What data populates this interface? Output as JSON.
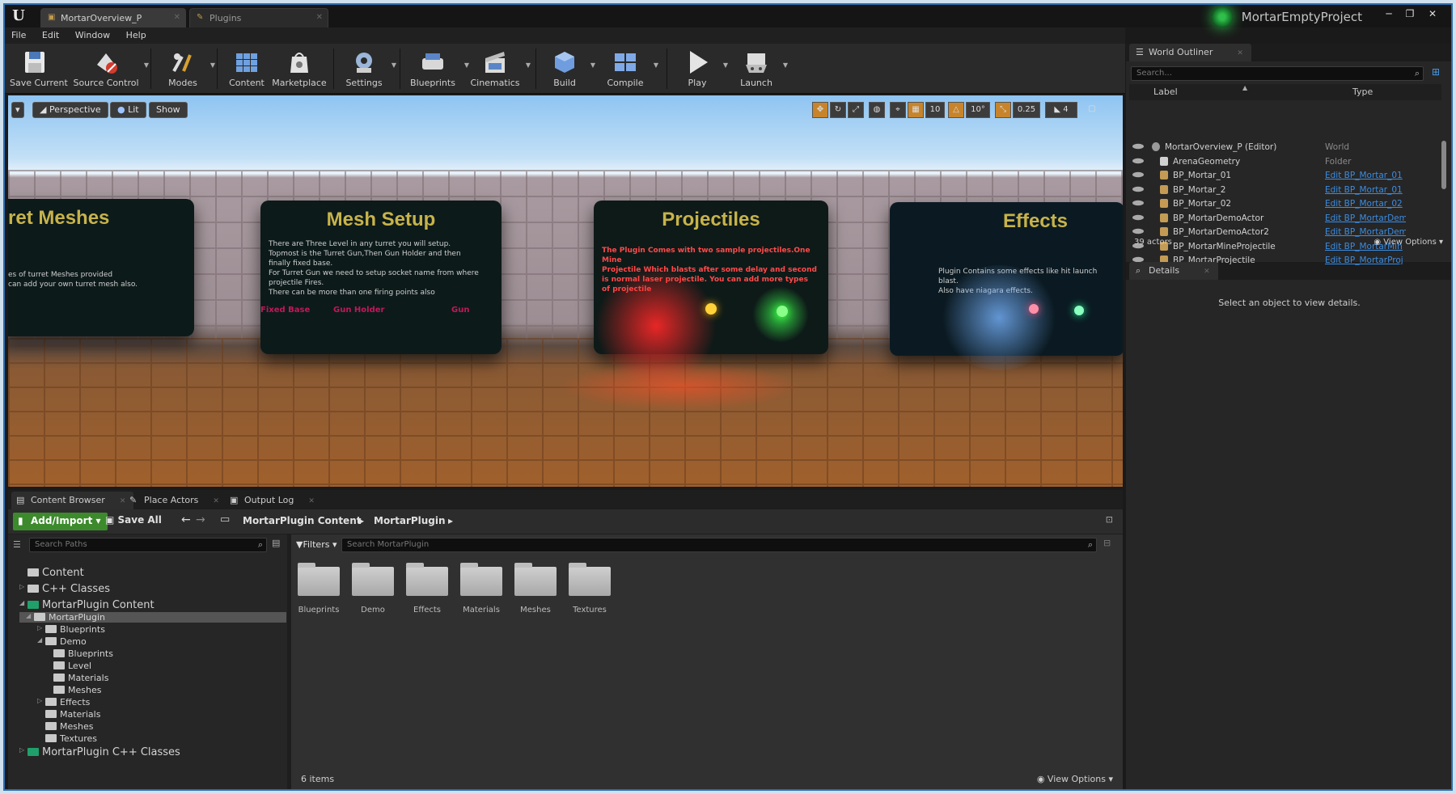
{
  "titlebar": {
    "logo": "U",
    "tabs": [
      {
        "label": "MortarOverview_P"
      },
      {
        "label": "Plugins"
      }
    ],
    "project_name": "MortarEmptyProject",
    "window_controls": [
      "─",
      "❐",
      "✕"
    ]
  },
  "menu": [
    "File",
    "Edit",
    "Window",
    "Help"
  ],
  "toolbar": {
    "save_current": "Save Current",
    "source_control": "Source Control",
    "modes": "Modes",
    "content": "Content",
    "marketplace": "Marketplace",
    "settings": "Settings",
    "blueprints": "Blueprints",
    "cinematics": "Cinematics",
    "build": "Build",
    "compile": "Compile",
    "play": "Play",
    "launch": "Launch"
  },
  "viewport": {
    "menu_arrow": "▾",
    "perspective": "Perspective",
    "lit": "Lit",
    "show": "Show",
    "grid_snap": "10",
    "rotation_snap": "10°",
    "scale_snap": "0.25",
    "camera_speed": "4",
    "panels": [
      {
        "title": "ret Meshes",
        "text": "es of turret Meshes provided\ncan add your own turret mesh also.",
        "red": false
      },
      {
        "title": "Mesh Setup",
        "text": "There are Three Level in any turret you will setup.\nTopmost is the Turret Gun,Then Gun Holder and then\nfinally fixed base.\nFor Turret Gun we need to setup socket name from where\nprojectile Fires.\nThere can be more than one firing points also",
        "red": false,
        "labels": [
          "Fixed Base",
          "Gun Holder",
          "Gun"
        ]
      },
      {
        "title": "Projectiles",
        "text": "The Plugin Comes with two sample projectiles.One Mine\nProjectile Which blasts after some delay and second\nis normal laser projectile. You can add more types\nof projectile",
        "red": true
      },
      {
        "title": "Effects",
        "text": "Plugin Contains some effects like hit launch blast.\nAlso have niagara effects.",
        "red": false
      }
    ]
  },
  "outliner": {
    "tab": "World Outliner",
    "search_placeholder": "Search...",
    "col_label": "Label",
    "col_type": "Type",
    "rows": [
      {
        "label": "MortarOverview_P (Editor)",
        "type": "World",
        "link": false,
        "indent": 0
      },
      {
        "label": "ArenaGeometry",
        "type": "Folder",
        "link": false,
        "indent": 1
      },
      {
        "label": "BP_Mortar_01",
        "type": "Edit BP_Mortar_01",
        "link": true,
        "indent": 1
      },
      {
        "label": "BP_Mortar_2",
        "type": "Edit BP_Mortar_01",
        "link": true,
        "indent": 1
      },
      {
        "label": "BP_Mortar_02",
        "type": "Edit BP_Mortar_02",
        "link": true,
        "indent": 1
      },
      {
        "label": "BP_MortarDemoActor",
        "type": "Edit BP_MortarDem",
        "link": true,
        "indent": 1
      },
      {
        "label": "BP_MortarDemoActor2",
        "type": "Edit BP_MortarDem",
        "link": true,
        "indent": 1
      },
      {
        "label": "BP_MortarMineProjectile",
        "type": "Edit BP_MortarMin",
        "link": true,
        "indent": 1
      },
      {
        "label": "BP_MortarProjectile",
        "type": "Edit BP_MortarProj",
        "link": true,
        "indent": 1
      }
    ],
    "actor_count": "39 actors",
    "view_options": "View Options"
  },
  "details": {
    "tab": "Details",
    "empty_text": "Select an object to view details."
  },
  "content_browser": {
    "tabs": [
      "Content Browser",
      "Place Actors",
      "Output Log"
    ],
    "add_import": "Add/Import",
    "save_all": "Save All",
    "breadcrumb": [
      "MortarPlugin Content",
      "MortarPlugin"
    ],
    "search_paths_placeholder": "Search Paths",
    "filters": "Filters",
    "search_placeholder": "Search MortarPlugin",
    "tree": [
      {
        "label": "Content",
        "level": 0,
        "big": true,
        "arrow": "",
        "green": false,
        "selected": false
      },
      {
        "label": "C++ Classes",
        "level": 0,
        "big": true,
        "arrow": "▷",
        "green": false,
        "selected": false
      },
      {
        "label": "MortarPlugin Content",
        "level": 0,
        "big": true,
        "arrow": "◢",
        "green": true,
        "selected": false
      },
      {
        "label": "MortarPlugin",
        "level": 1,
        "big": false,
        "arrow": "◢",
        "green": false,
        "selected": true
      },
      {
        "label": "Blueprints",
        "level": 2,
        "big": false,
        "arrow": "▷",
        "green": false,
        "selected": false
      },
      {
        "label": "Demo",
        "level": 2,
        "big": false,
        "arrow": "◢",
        "green": false,
        "selected": false
      },
      {
        "label": "Blueprints",
        "level": 3,
        "big": false,
        "arrow": "",
        "green": false,
        "selected": false
      },
      {
        "label": "Level",
        "level": 3,
        "big": false,
        "arrow": "",
        "green": false,
        "selected": false
      },
      {
        "label": "Materials",
        "level": 3,
        "big": false,
        "arrow": "",
        "green": false,
        "selected": false
      },
      {
        "label": "Meshes",
        "level": 3,
        "big": false,
        "arrow": "",
        "green": false,
        "selected": false
      },
      {
        "label": "Effects",
        "level": 2,
        "big": false,
        "arrow": "▷",
        "green": false,
        "selected": false
      },
      {
        "label": "Materials",
        "level": 2,
        "big": false,
        "arrow": "",
        "green": false,
        "selected": false
      },
      {
        "label": "Meshes",
        "level": 2,
        "big": false,
        "arrow": "",
        "green": false,
        "selected": false
      },
      {
        "label": "Textures",
        "level": 2,
        "big": false,
        "arrow": "",
        "green": false,
        "selected": false
      },
      {
        "label": "MortarPlugin C++ Classes",
        "level": 0,
        "big": true,
        "arrow": "▷",
        "green": true,
        "selected": false
      }
    ],
    "folders": [
      "Blueprints",
      "Demo",
      "Effects",
      "Materials",
      "Meshes",
      "Textures"
    ],
    "item_count": "6 items",
    "view_options": "View Options"
  },
  "colors": {
    "accent_blue": "#2d6fb0",
    "link_blue": "#3c8ce0",
    "add_green": "#3c8a2c",
    "panel_title": "#c7b34a"
  }
}
